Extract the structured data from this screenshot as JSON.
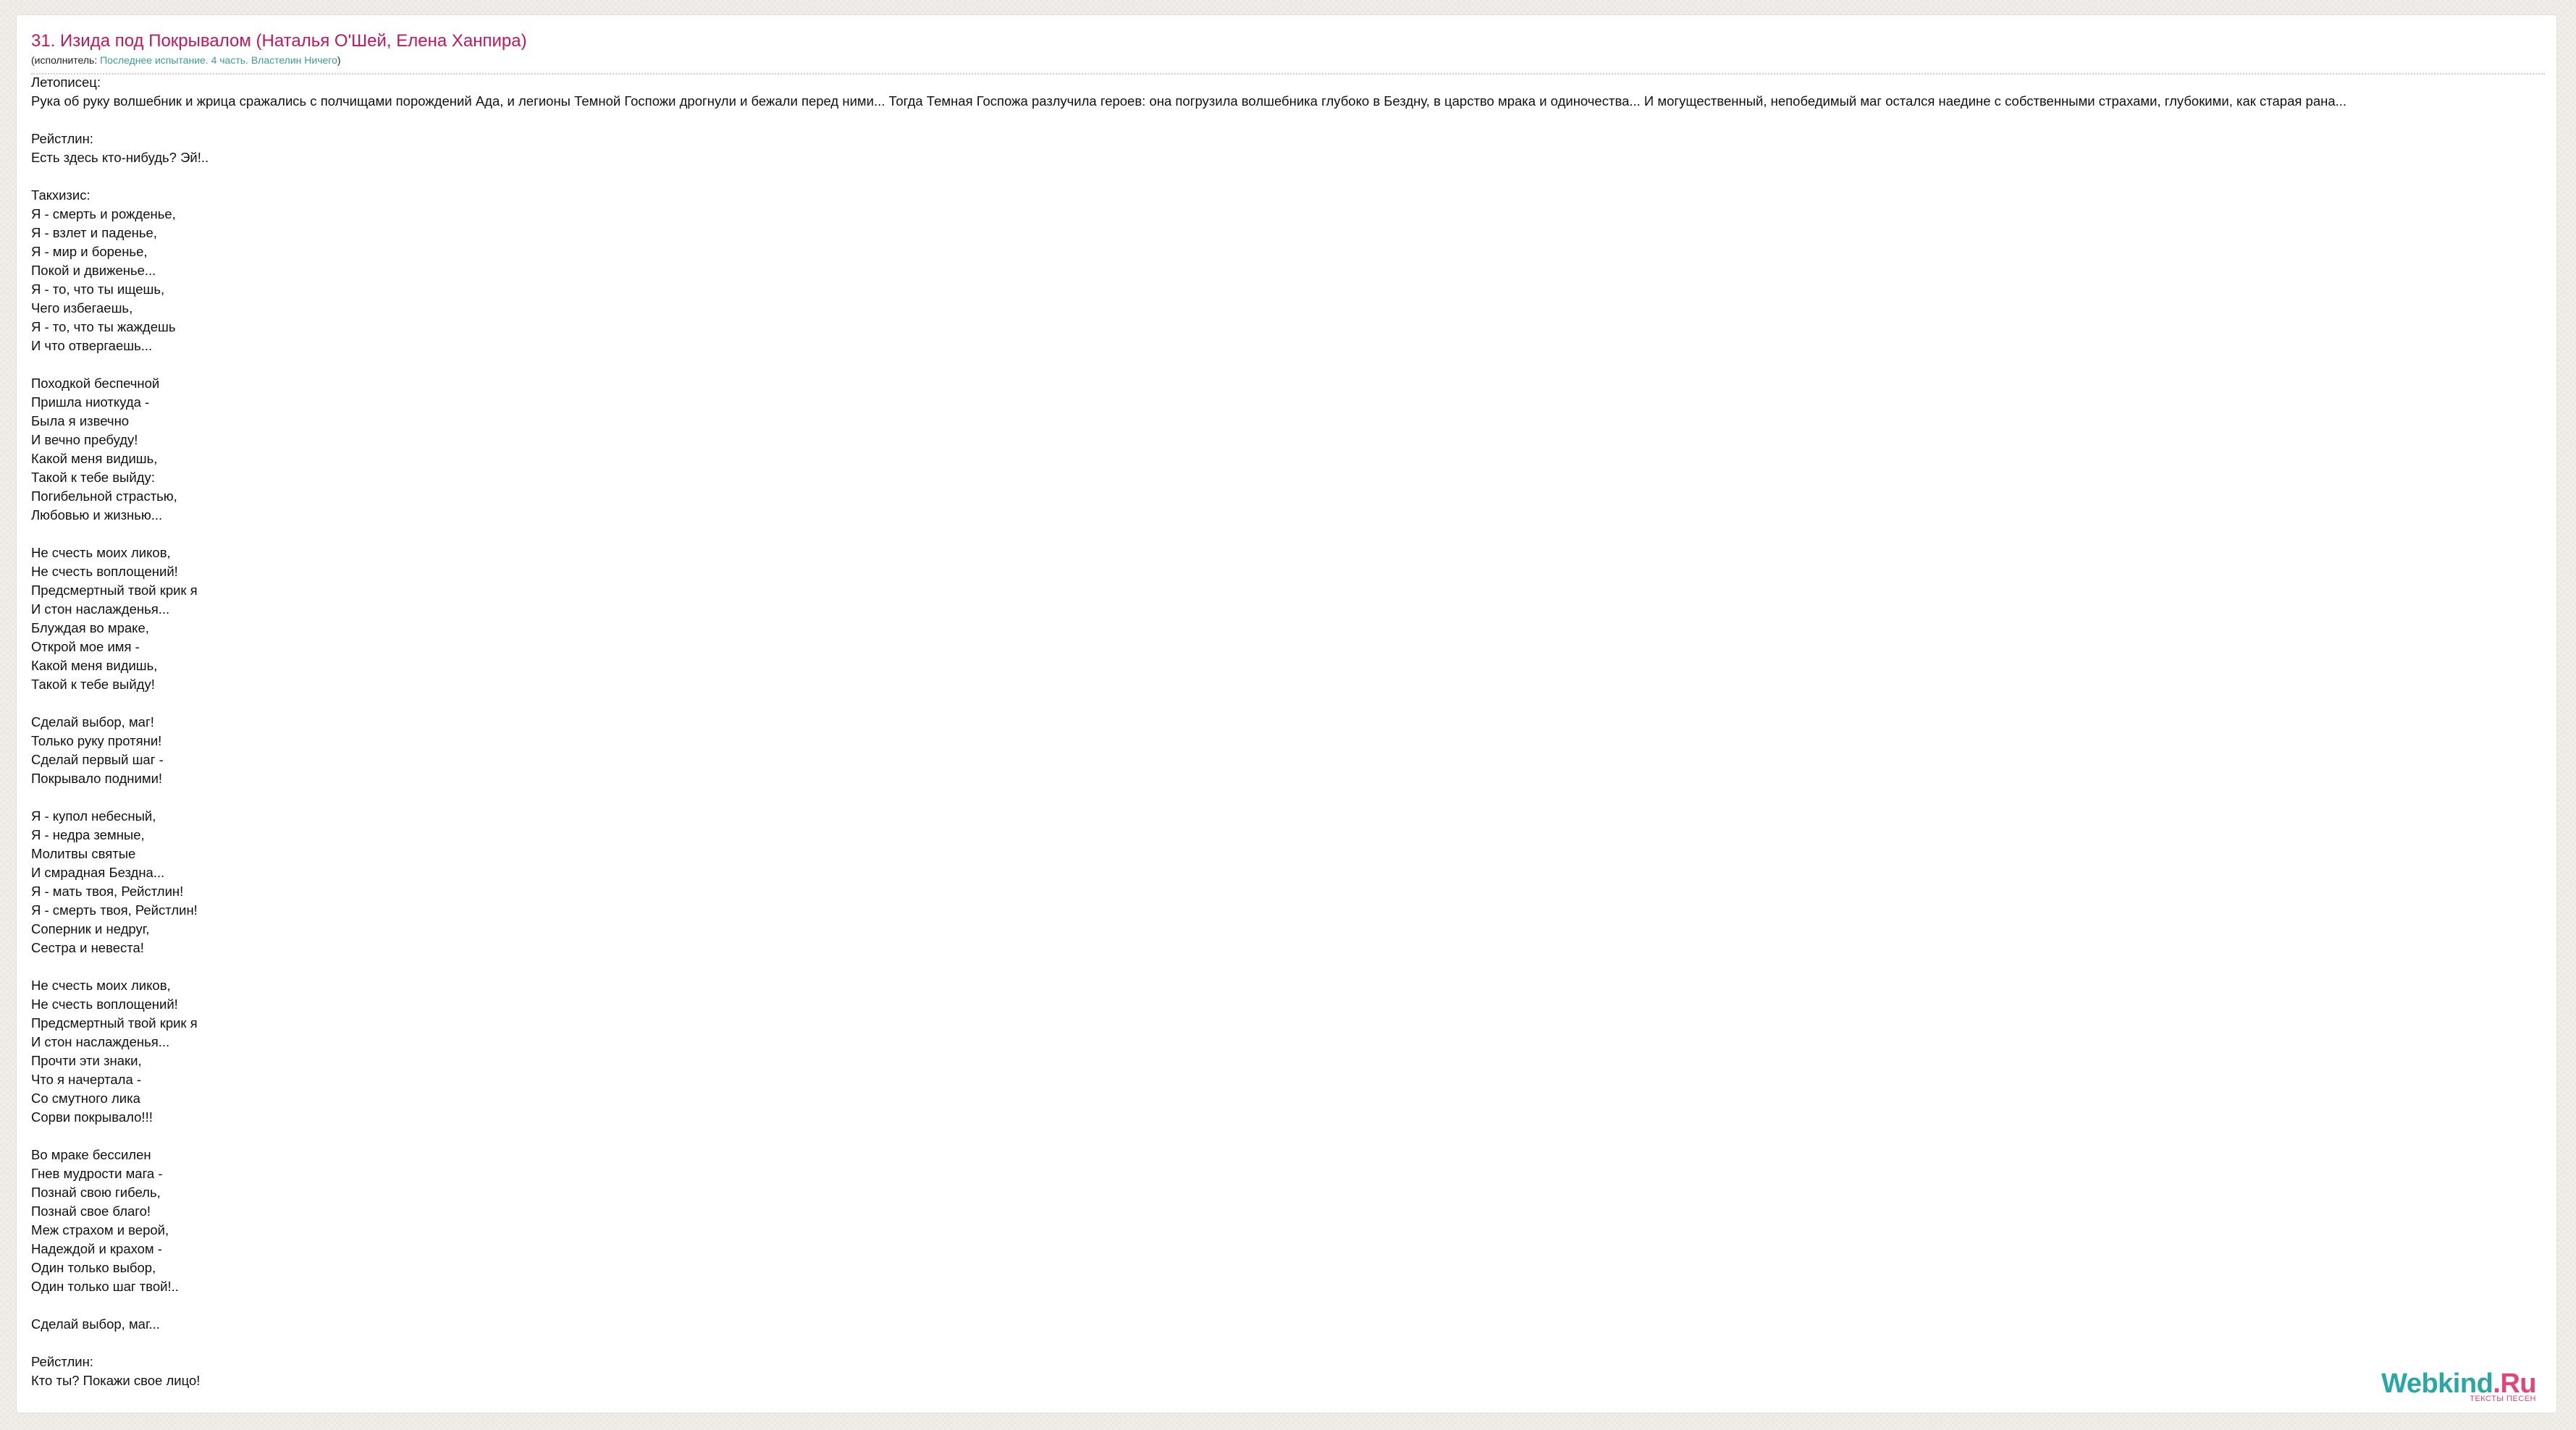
{
  "header": {
    "title": "31. Изида под Покрывалом (Наталья О'Шей, Елена Ханпира)",
    "performer_prefix": "(исполнитель: ",
    "performer_link": "Последнее испытание. 4 часть. Властелин Ничего",
    "performer_suffix": ")"
  },
  "lyrics": [
    "Летописец:",
    "Рука об руку волшебник и жрица сражались с полчищами порождений Ада, и легионы Темной Госпожи дрогнули и бежали перед ними... Тогда Темная Госпожа разлучила героев: она погрузила волшебника глубоко в Бездну, в царство мрака и одиночества... И могущественный, непобедимый маг остался наедине с собственными страхами, глубокими, как старая рана...",
    "",
    "Рейстлин:",
    "Есть здесь кто-нибудь? Эй!..",
    "",
    "Такхизис:",
    "Я - смерть и рожденье,",
    "Я - взлет и паденье,",
    "Я - мир и боренье,",
    "Покой и движенье...",
    "Я - то, что ты ищешь,",
    "Чего избегаешь,",
    "Я - то, что ты жаждешь",
    "И что отвергаешь...",
    "",
    "Походкой беспечной",
    "Пришла ниоткуда -",
    "Была я извечно",
    "И вечно пребуду!",
    "Какой меня видишь,",
    "Такой к тебе выйду:",
    "Погибельной страстью,",
    "Любовью и жизнью...",
    "",
    "Не счесть моих ликов,",
    "Не счесть воплощений!",
    "Предсмертный твой крик я",
    "И стон наслажденья...",
    "Блуждая во мраке,",
    "Открой мое имя -",
    "Какой меня видишь,",
    "Такой к тебе выйду!",
    "",
    "Сделай выбор, маг!",
    "Только руку протяни!",
    "Сделай первый шаг -",
    "Покрывало подними!",
    "",
    "Я - купол небесный,",
    "Я - недра земные,",
    "Молитвы святые",
    "И смрадная Бездна...",
    "Я - мать твоя, Рейстлин!",
    "Я - смерть твоя, Рейстлин!",
    "Соперник и недруг,",
    "Сестра и невеста!",
    "",
    "Не счесть моих ликов,",
    "Не счесть воплощений!",
    "Предсмертный твой крик я",
    "И стон наслажденья...",
    "Прочти эти знаки,",
    "Что я начертала -",
    "Со смутного лика",
    "Сорви покрывало!!!",
    "",
    "Во мраке бессилен",
    "Гнев мудрости мага -",
    "Познай свою гибель,",
    "Познай свое благо!",
    "Меж страхом и верой,",
    "Надеждой и крахом -",
    "Один только выбор,",
    "Один только шаг твой!..",
    "",
    "Сделай выбор, маг...",
    "",
    "Рейстлин:",
    "Кто ты? Покажи свое лицо!"
  ],
  "logo": {
    "name": "Webkind",
    "tld": ".Ru",
    "tagline": "ТЕКСТЫ ПЕСЕН"
  },
  "colors": {
    "title": "#c2185b",
    "link": "#3d9a9b",
    "logo_main": "#2aa6a4",
    "logo_accent": "#e0457b"
  }
}
